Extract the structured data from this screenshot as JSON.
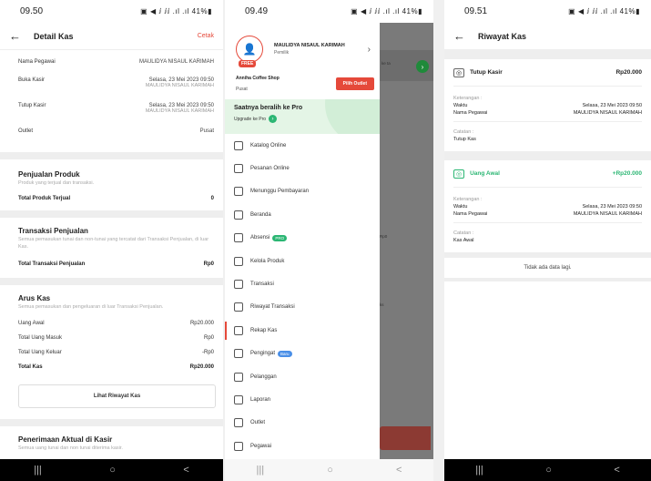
{
  "p1": {
    "status": {
      "time": "09.50",
      "icons": "▣ ◀ ⅈ ⅈⅈ .ıl .ıl 41%▮"
    },
    "appbar": {
      "title": "Detail Kas",
      "action": "Cetak"
    },
    "info": [
      {
        "label": "Nama Pegawai",
        "value": "MAULIDYA NISAUL KARIMAH",
        "sub": ""
      },
      {
        "label": "Buka Kasir",
        "value": "Selasa, 23 Mei 2023 09:50",
        "sub": "MAULIDYA NISAUL KARIMAH"
      },
      {
        "label": "Tutup Kasir",
        "value": "Selasa, 23 Mei 2023 09:50",
        "sub": "MAULIDYA NISAUL KARIMAH"
      },
      {
        "label": "Outlet",
        "value": "Pusat",
        "sub": ""
      }
    ],
    "penjualan": {
      "title": "Penjualan Produk",
      "desc": "Produk yang terjual dan transaksi.",
      "total_label": "Total Produk Terjual",
      "total_value": "0"
    },
    "transaksi": {
      "title": "Transaksi Penjualan",
      "desc": "Semua pemasukan tunai dan non-tunai yang tercatat dari Transaksi Penjualan, di luar Kas.",
      "total_label": "Total Transaksi Penjualan",
      "total_value": "Rp0"
    },
    "arus": {
      "title": "Arus Kas",
      "desc": "Semua pemasukan dan pengeluaran di luar Transaksi Penjualan.",
      "rows": [
        {
          "label": "Uang Awal",
          "value": "Rp20.000"
        },
        {
          "label": "Total Uang Masuk",
          "value": "Rp0"
        },
        {
          "label": "Total Uang Keluar",
          "value": "-Rp0"
        },
        {
          "label": "Total Kas",
          "value": "Rp20.000"
        }
      ],
      "button": "Lihat Riwayat Kas"
    },
    "penerimaan": {
      "title": "Penerimaan Aktual di Kasir",
      "desc": "Semua uang tunai dan non tunai diterima kasir."
    },
    "nav": [
      "|||",
      "○",
      "<"
    ]
  },
  "p2": {
    "status": {
      "time": "09.49",
      "icons": "▣ ◀ ⅈ ⅈⅈ .ıl .ıl 41%▮"
    },
    "profile": {
      "name": "MAULIDYA NISAUL KARIMAH",
      "role": "Pemilik",
      "plan": "FREE"
    },
    "shop": {
      "name": "Anniha Coffee Shop",
      "outlet": "Pusat",
      "button": "Pilih Outlet"
    },
    "promo": {
      "title": "Saatnya beralih ke Pro",
      "link": "Upgrade ke Pro"
    },
    "menu": [
      {
        "label": "Katalog Online",
        "icon": "sitemap-icon",
        "badge": "",
        "badge_color": ""
      },
      {
        "label": "Pesanan Online",
        "icon": "bag-icon",
        "badge": "",
        "badge_color": ""
      },
      {
        "label": "Menunggu Pembayaran",
        "icon": "wallet-icon",
        "badge": "",
        "badge_color": ""
      },
      {
        "label": "Beranda",
        "icon": "home-icon",
        "badge": "",
        "badge_color": ""
      },
      {
        "label": "Absensi",
        "icon": "calendar-icon",
        "badge": "PRO",
        "badge_color": "#2bb673"
      },
      {
        "label": "Kelola Produk",
        "icon": "box-icon",
        "badge": "",
        "badge_color": ""
      },
      {
        "label": "Transaksi",
        "icon": "receipt-icon",
        "badge": "",
        "badge_color": ""
      },
      {
        "label": "Riwayat Transaksi",
        "icon": "search-doc-icon",
        "badge": "",
        "badge_color": ""
      },
      {
        "label": "Rekap Kas",
        "icon": "cash-cycle-icon",
        "badge": "",
        "badge_color": ""
      },
      {
        "label": "Pengingat",
        "icon": "bell-icon",
        "badge": "Baru",
        "badge_color": "#4a8fe7"
      },
      {
        "label": "Pelanggan",
        "icon": "user-card-icon",
        "badge": "",
        "badge_color": ""
      },
      {
        "label": "Laporan",
        "icon": "report-icon",
        "badge": "",
        "badge_color": ""
      },
      {
        "label": "Outlet",
        "icon": "store-icon",
        "badge": "",
        "badge_color": ""
      },
      {
        "label": "Pegawai",
        "icon": "staff-icon",
        "badge": "",
        "badge_color": ""
      }
    ],
    "overlay_snippets": [
      "ke ta",
      "Rp0",
      "ks"
    ],
    "nav": [
      "|||",
      "○",
      "<"
    ]
  },
  "p3": {
    "status": {
      "time": "09.51",
      "icons": "▣ ◀ ⅈ ⅈⅈ .ıl .ıl 41%▮"
    },
    "appbar": {
      "title": "Riwayat Kas"
    },
    "entries": [
      {
        "type": "Tutup Kasir",
        "amount": "Rp20.000",
        "amount_color": "#222",
        "type_color": "#222",
        "keterangan": "Keterangan :",
        "waktu_label": "Waktu",
        "waktu": "Selasa, 23 Mei 2023 09:50",
        "pegawai_label": "Nama Pegawai",
        "pegawai": "MAULIDYA NISAUL KARIMAH",
        "catatan_label": "Catatan :",
        "catatan": "Tutup Kas"
      },
      {
        "type": "Uang Awal",
        "amount": "+Rp20.000",
        "amount_color": "#2bb673",
        "type_color": "#2bb673",
        "keterangan": "Keterangan :",
        "waktu_label": "Waktu",
        "waktu": "Selasa, 23 Mei 2023 09:50",
        "pegawai_label": "Nama Pegawai",
        "pegawai": "MAULIDYA NISAUL KARIMAH",
        "catatan_label": "Catatan :",
        "catatan": "Kas Awal"
      }
    ],
    "end_text": "Tidak ada data lagi.",
    "nav": [
      "|||",
      "○",
      "<"
    ]
  }
}
